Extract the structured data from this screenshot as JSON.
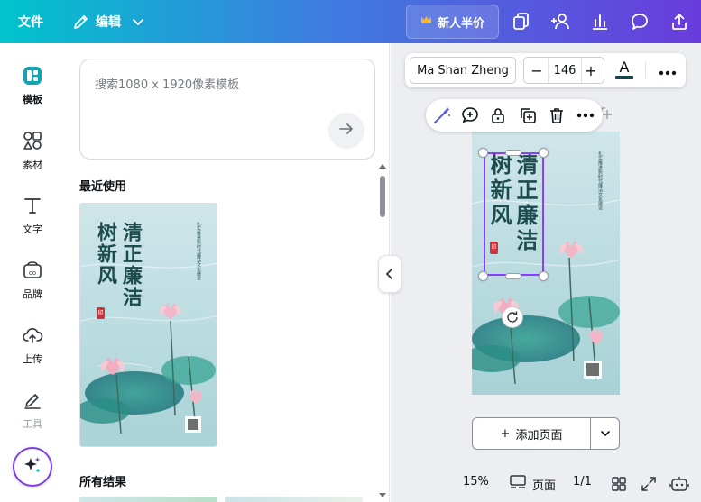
{
  "header": {
    "file_label": "文件",
    "edit_label": "编辑",
    "promo_label": "新人半价"
  },
  "rail": {
    "items": [
      {
        "label": "模板",
        "icon": "templates-icon"
      },
      {
        "label": "素材",
        "icon": "elements-icon"
      },
      {
        "label": "文字",
        "icon": "text-icon"
      },
      {
        "label": "品牌",
        "icon": "brand-icon"
      },
      {
        "label": "上传",
        "icon": "upload-icon"
      },
      {
        "label": "工具",
        "icon": "tools-icon"
      }
    ]
  },
  "panel": {
    "search_placeholder": "搜索1080 x 1920像素模板",
    "recent_title": "最近使用",
    "all_results_title": "所有结果"
  },
  "design": {
    "title_col1": "清正廉洁",
    "title_col2": "树新风",
    "seal_text": "印",
    "subtitle": "扎实推进新时代廉洁文化建设"
  },
  "fontbar": {
    "font_name": "Ma Shan Zheng",
    "font_size": "146",
    "minus": "−",
    "plus": "+",
    "color_glyph": "A",
    "text_color": "#17424a"
  },
  "canvas": {
    "add_page_label": "添加页面",
    "add_page_plus": "+"
  },
  "footer": {
    "zoom": "15%",
    "pages_label": "页面",
    "page_count": "1/1"
  },
  "colors": {
    "accent": "#8b3dff",
    "header_start": "#00c4cc",
    "header_end": "#6a3bdc"
  }
}
